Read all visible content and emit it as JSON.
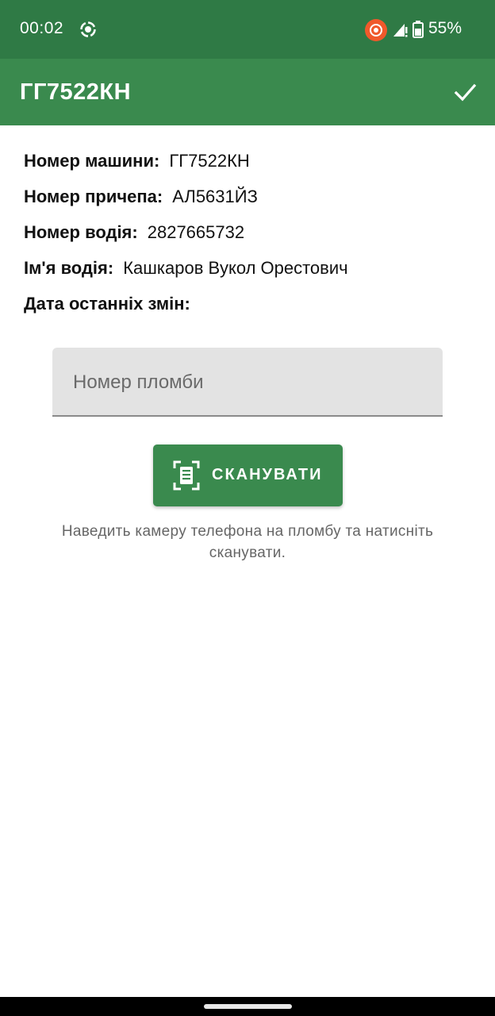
{
  "status_bar": {
    "time": "00:02",
    "battery": "55%",
    "icons": [
      "screen-record-icon",
      "cast-icon",
      "signal-icon",
      "battery-icon"
    ],
    "cast_color": "#f0592b"
  },
  "app_bar": {
    "title": "ГГ7522КН",
    "action_icon": "check-icon",
    "color": "#3a8a4e"
  },
  "info": {
    "car_number": {
      "label": "Номер машини:",
      "value": "ГГ7522КН"
    },
    "trailer_number": {
      "label": "Номер причепа:",
      "value": "АЛ5631ЙЗ"
    },
    "driver_number": {
      "label": "Номер водія:",
      "value": "2827665732"
    },
    "driver_name": {
      "label": "Ім'я водія:",
      "value": "Кашкаров Вукол Орестович"
    },
    "last_change_date": {
      "label": "Дата останніх змін:",
      "value": ""
    }
  },
  "seal_field": {
    "placeholder": "Номер пломби",
    "value": ""
  },
  "scan_button": {
    "label": "СКАНУВАТИ",
    "icon": "document-scanner-icon"
  },
  "hint": "Наведить камеру телефона на пломбу та натисніть сканувати."
}
